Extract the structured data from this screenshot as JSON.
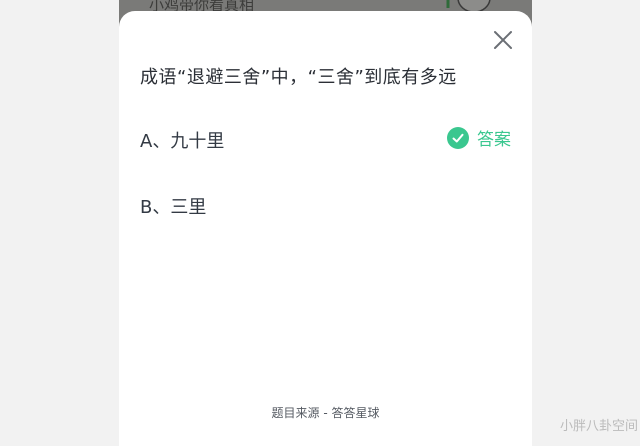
{
  "background_app": {
    "partial_text": "小鸡带你看真相"
  },
  "dialog": {
    "question": "成语“退避三舍”中，“三舍”到底有多远",
    "options": [
      {
        "label": "A、九十里",
        "is_answer": true
      },
      {
        "label": "B、三里",
        "is_answer": false
      }
    ],
    "answer_tag": "答案",
    "source": "题目来源 - 答答星球",
    "close_icon": "close-icon",
    "check_icon": "check-icon"
  },
  "watermark": "小胖八卦空间",
  "colors": {
    "accent_green": "#3ac78f",
    "question_text": "#2b2f36",
    "backdrop_dim": "#7a7a78"
  }
}
